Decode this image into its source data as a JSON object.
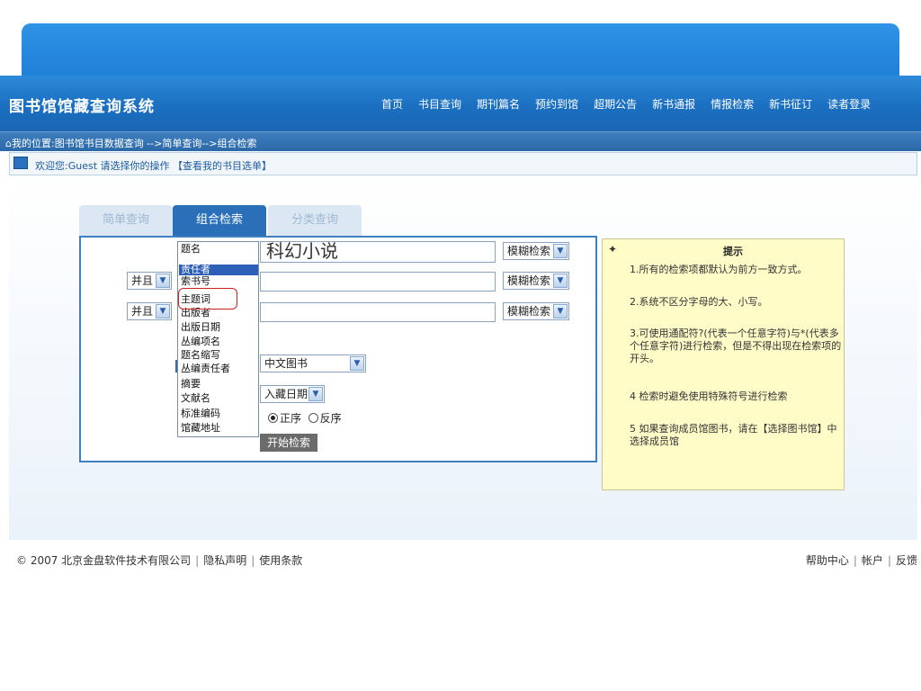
{
  "header": {
    "site_title": "图书馆馆藏查询系统",
    "nav": [
      "首页",
      "书目查询",
      "期刊篇名",
      "预约到馆",
      "超期公告",
      "新书通报",
      "情报检索",
      "新书征订",
      "读者登录"
    ]
  },
  "breadcrumb": {
    "text": "我的位置:图书馆书目数据查询 -->简单查询-->组合检索"
  },
  "welcome": {
    "text": "欢迎您:Guest 请选择你的操作",
    "link": "【查看我的书目选单】"
  },
  "tabs": [
    "简单查询",
    "组合检索",
    "分类查询"
  ],
  "search": {
    "input1_value": "科幻小说",
    "mode_options": [
      "模糊检索",
      "模糊检索",
      "模糊检索"
    ],
    "logic_options": [
      "并且",
      "并且"
    ],
    "library_select": "中文图书",
    "sort_select": "入藏日期",
    "order_asc": "正序",
    "order_desc": "反序",
    "start_button": "开始检索"
  },
  "field_dropdown": {
    "items": [
      "题名",
      "责任者",
      "索书号",
      "主题词",
      "出版者",
      "出版日期",
      "丛编项名",
      "题名缩写",
      "丛编责任者",
      "摘要",
      "文献名",
      "标准编码",
      "馆藏地址"
    ],
    "highlighted_index": 1,
    "circled_index": 3
  },
  "tips": {
    "title": "提示",
    "items": [
      "1.所有的检索项都默认为前方一致方式。",
      "2.系统不区分字母的大、小写。",
      "3.可使用通配符?(代表一个任意字符)与*(代表多个任意字符)进行检索，但是不得出现在检索项的开头。",
      "4 检索时避免使用特殊符号进行检索",
      "5 如果查询成员馆图书，请在【选择图书馆】中选择成员馆"
    ]
  },
  "footer": {
    "copyright": "© 2007 北京金盘软件技术有限公司",
    "privacy": "隐私声明",
    "terms": "使用条款",
    "help": "帮助中心",
    "account": "帐户",
    "feedback": "反馈"
  },
  "colors": {
    "nav_blue": "#1b6fc1",
    "active_tab": "#2b6fb8",
    "tips_bg": "#fffcc8"
  }
}
